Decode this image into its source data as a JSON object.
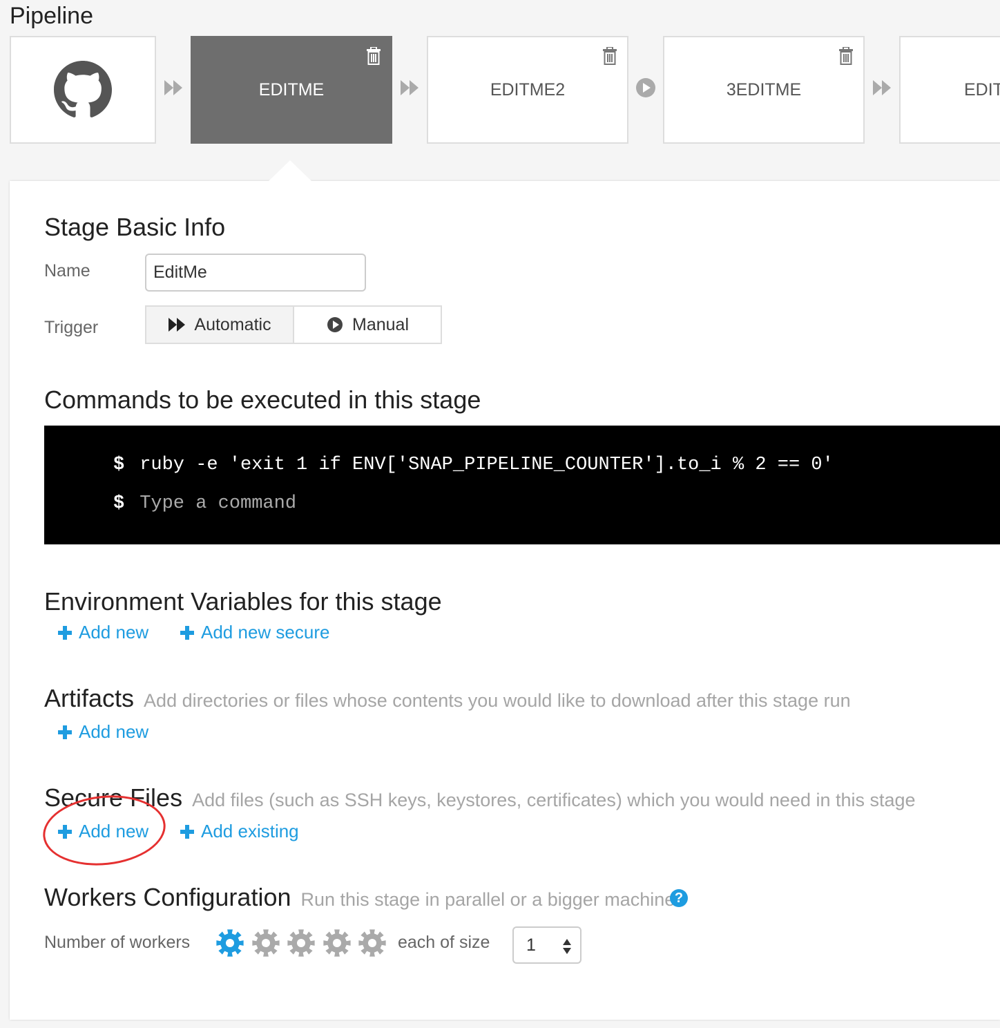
{
  "pipeline": {
    "title": "Pipeline",
    "stages": [
      {
        "name": "EDITME",
        "selected": true
      },
      {
        "name": "EDITME2",
        "selected": false
      },
      {
        "name": "3EDITME",
        "selected": false
      },
      {
        "name": "EDIT",
        "selected": false
      }
    ],
    "source_icon": "github-icon",
    "connectors": [
      "automatic",
      "automatic",
      "manual",
      "automatic"
    ]
  },
  "basic_info": {
    "title": "Stage Basic Info",
    "name_label": "Name",
    "name_value": "EditMe",
    "trigger_label": "Trigger",
    "trigger_automatic": "Automatic",
    "trigger_manual": "Manual",
    "trigger_selected": "Automatic"
  },
  "commands": {
    "title": "Commands to be executed in this stage",
    "prompt": "$",
    "lines": [
      "ruby -e 'exit 1 if ENV['SNAP_PIPELINE_COUNTER'].to_i % 2 == 0'"
    ],
    "placeholder": "Type a command"
  },
  "env_vars": {
    "title": "Environment Variables for this stage",
    "add_new": "Add new",
    "add_new_secure": "Add new secure"
  },
  "artifacts": {
    "title": "Artifacts",
    "description": "Add directories or files whose contents you would like to download after this stage run",
    "add_new": "Add new"
  },
  "secure_files": {
    "title": "Secure Files",
    "description": "Add files (such as SSH keys, keystores, certificates) which you would need in this stage",
    "add_new": "Add new",
    "add_existing": "Add existing"
  },
  "workers": {
    "title": "Workers Configuration",
    "description": "Run this stage in parallel or a bigger machine",
    "help": "?",
    "number_label": "Number of workers",
    "selected_workers": 1,
    "max_workers": 5,
    "size_label": "each of size",
    "size_value": "1"
  },
  "colors": {
    "accent": "#1e9ce0",
    "selected_stage": "#6e6e6e",
    "gear_inactive": "#aaaaaa",
    "annotation": "#e53030"
  }
}
